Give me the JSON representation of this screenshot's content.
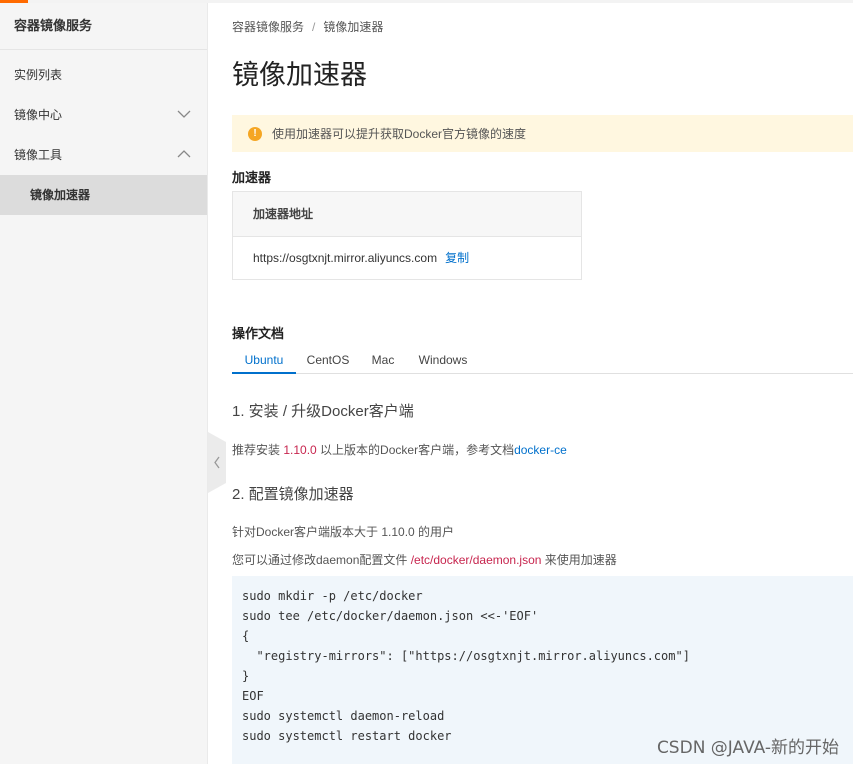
{
  "sidebar": {
    "title": "容器镜像服务",
    "items": [
      {
        "label": "实例列表"
      },
      {
        "label": "镜像中心"
      },
      {
        "label": "镜像工具"
      }
    ],
    "active_sub": "镜像加速器"
  },
  "breadcrumb": {
    "root": "容器镜像服务",
    "sep": "/",
    "current": "镜像加速器"
  },
  "page_title": "镜像加速器",
  "notice": {
    "icon": "!",
    "text": "使用加速器可以提升获取Docker官方镜像的速度"
  },
  "accelerator": {
    "section_title": "加速器",
    "column_header": "加速器地址",
    "address": "https://osgtxnjt.mirror.aliyuncs.com",
    "copy_label": "复制"
  },
  "docs": {
    "section_title": "操作文档",
    "tabs": [
      "Ubuntu",
      "CentOS",
      "Mac",
      "Windows"
    ],
    "active_tab": "Ubuntu",
    "step1": {
      "title": "1. 安装 / 升级Docker客户端",
      "text_pre": "推荐安装 ",
      "version": "1.10.0",
      "text_mid": " 以上版本的Docker客户端，参考文档",
      "link": "docker-ce"
    },
    "step2": {
      "title": "2. 配置镜像加速器",
      "line1": "针对Docker客户端版本大于 1.10.0 的用户",
      "line2_pre": "您可以通过修改daemon配置文件 ",
      "line2_path": "/etc/docker/daemon.json",
      "line2_post": " 来使用加速器"
    },
    "code": [
      "sudo mkdir -p /etc/docker",
      "sudo tee /etc/docker/daemon.json <<-'EOF'",
      "{",
      "  \"registry-mirrors\": [\"https://osgtxnjt.mirror.aliyuncs.com\"]",
      "}",
      "EOF",
      "sudo systemctl daemon-reload",
      "sudo systemctl restart docker"
    ]
  },
  "watermark": "CSDN @JAVA-新的开始",
  "colors": {
    "accent": "#ff6a00",
    "link": "#0070cc",
    "highlight": "#c7254e",
    "notice_bg": "#fff7e0",
    "code_bg": "#f0f6fb"
  },
  "icons": [
    "chevron-down-icon",
    "chevron-up-icon",
    "warning-icon",
    "chevron-left-icon"
  ]
}
